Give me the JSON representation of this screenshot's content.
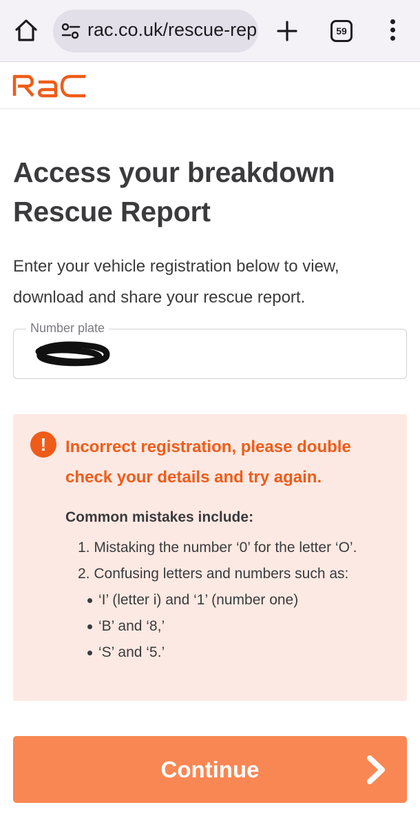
{
  "browser": {
    "url": "rac.co.uk/rescue-rep",
    "tab_count": "59",
    "icons": {
      "home": "home-icon",
      "site_settings": "tune-icon",
      "new_tab": "plus-icon",
      "tabs": "tab-switcher-icon",
      "menu": "more-vert-icon"
    }
  },
  "header": {
    "logo_text": "RAC",
    "brand_color": "#ef5c19"
  },
  "main": {
    "title": "Access your breakdown Rescue Report",
    "intro": "Enter your vehicle registration below to view, download and share your rescue report.",
    "number_plate": {
      "label": "Number plate",
      "value": ""
    },
    "error": {
      "icon": "exclamation-icon",
      "message": "Incorrect registration, please double check your details and try again.",
      "mistakes_heading": "Common mistakes include:",
      "mistakes": [
        "1. Mistaking the number ‘0’ for the letter ‘O’.",
        "2. Confusing letters and numbers such as:"
      ],
      "examples": [
        "‘I’ (letter i) and ‘1’ (number one)",
        "‘B’ and ‘8,’",
        "‘S’ and ‘5.’"
      ],
      "background_color": "#fde9e3",
      "text_color": "#ef5c19"
    },
    "continue_button": {
      "label": "Continue",
      "color": "#f98753"
    }
  }
}
